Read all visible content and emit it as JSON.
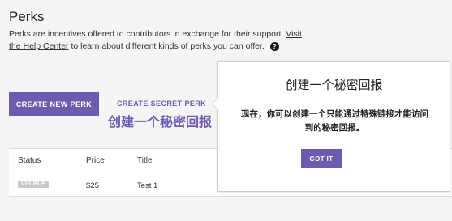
{
  "page": {
    "title": "Perks",
    "description": "Perks are incentives offered to contributors in exchange for their support.",
    "help_link": "Visit the Help Center",
    "description_tail": " to learn about different kinds of perks you can offer.",
    "help_icon": "?"
  },
  "actions": {
    "create_perk": "CREATE NEW PERK",
    "create_secret_perk": "CREATE SECRET PERK",
    "create_secret_perk_cn": "创建一个秘密回报"
  },
  "table": {
    "headers": [
      "Status",
      "Price",
      "Title"
    ],
    "rows": [
      {
        "status": "VISIBLE",
        "price": "$25",
        "title": "Test 1"
      }
    ]
  },
  "tooltip": {
    "title": "创建一个秘密回报",
    "body": "现在，你可以创建一个只能通过特殊链接才能访问到的秘密回报。",
    "button": "GOT IT"
  },
  "colors": {
    "accent": "#6d5bb0",
    "badge": "#c8c8c8"
  }
}
